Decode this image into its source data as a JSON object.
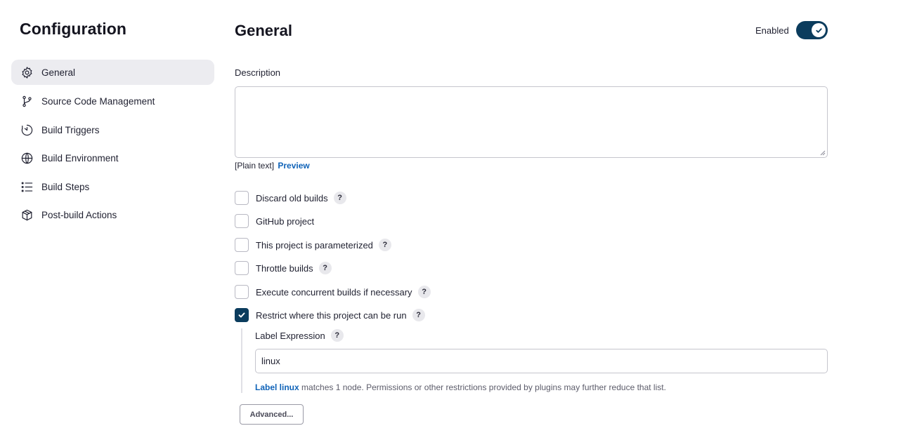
{
  "sidebar": {
    "title": "Configuration",
    "items": [
      {
        "label": "General",
        "icon": "gear-icon",
        "active": true
      },
      {
        "label": "Source Code Management",
        "icon": "git-branch-icon",
        "active": false
      },
      {
        "label": "Build Triggers",
        "icon": "timer-icon",
        "active": false
      },
      {
        "label": "Build Environment",
        "icon": "globe-icon",
        "active": false
      },
      {
        "label": "Build Steps",
        "icon": "list-icon",
        "active": false
      },
      {
        "label": "Post-build Actions",
        "icon": "package-icon",
        "active": false
      }
    ]
  },
  "main": {
    "title": "General",
    "enabled_label": "Enabled",
    "enabled": true,
    "description": {
      "label": "Description",
      "value": "",
      "format_label": "[Plain text]",
      "preview_link": "Preview"
    },
    "options": [
      {
        "label": "Discard old builds",
        "checked": false,
        "help": true
      },
      {
        "label": "GitHub project",
        "checked": false,
        "help": false
      },
      {
        "label": "This project is parameterized",
        "checked": false,
        "help": true
      },
      {
        "label": "Throttle builds",
        "checked": false,
        "help": true
      },
      {
        "label": "Execute concurrent builds if necessary",
        "checked": false,
        "help": true
      },
      {
        "label": "Restrict where this project can be run",
        "checked": true,
        "help": true
      }
    ],
    "help_glyph": "?",
    "label_expression": {
      "label": "Label Expression",
      "value": "linux",
      "match_link": "Label linux",
      "match_text": " matches 1 node. Permissions or other restrictions provided by plugins may further reduce that list."
    },
    "advanced_button": "Advanced..."
  },
  "colors": {
    "accent": "#0b3c5d",
    "link": "#1063b8",
    "active_bg": "#ececf0"
  }
}
